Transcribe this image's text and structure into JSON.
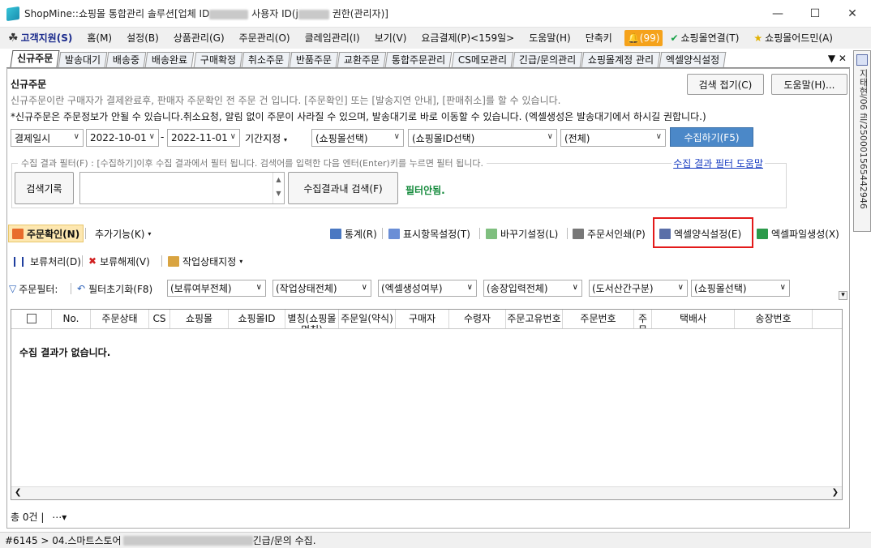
{
  "window": {
    "title_prefix": "ShopMine::쇼핑몰 통합관리 솔루션[업체 ID",
    "title_mid": " 사용자 ID(j",
    "title_suffix": " 권한(관리자)]",
    "minimize": "—",
    "maximize": "☐",
    "close": "✕"
  },
  "menu": {
    "brand": "고객지원(S)",
    "items": [
      "홈(M)",
      "설정(B)",
      "상품관리(G)",
      "주문관리(O)",
      "클레임관리(I)",
      "보기(V)",
      "요금결제(P)<159일>",
      "도움말(H)",
      "단축키"
    ],
    "bell_count": "(99)",
    "mall_connect": "쇼핑몰연결(T)",
    "mall_admin": "쇼핑몰어드민(A)"
  },
  "tabs": [
    "신규주문",
    "발송대기",
    "배송중",
    "배송완료",
    "구매확정",
    "취소주문",
    "반품주문",
    "교환주문",
    "통합주문관리",
    "CS메모관리",
    "긴급/문의관리",
    "쇼핑몰계정 관리",
    "엑셀양식설정"
  ],
  "tab_controls": "▼ ✕",
  "side_strip": "지태현/06 fil/250001565442946",
  "panel": {
    "title": "신규주문",
    "desc1": "신규주문이란 구매자가 결제완료후, 판매자 주문확인 전 주문 건 입니다. [주문확인] 또는 [발송지연 안내], [판매취소]를 할 수 있습니다.",
    "desc2": "*신규주문은 주문정보가 안될 수 있습니다.취소요청, 알림 없이 주문이 사라질 수 있으며, 발송대기로 바로 이동할 수 있습니다. (엑셀생성은 발송대기에서 하시길 권합니다.)",
    "btn_collapse": "검색 접기(C)",
    "btn_help": "도움말(H)..."
  },
  "search": {
    "date_type": "결제일시",
    "date_from": "2022-10-01",
    "date_sep": "-",
    "date_to": "2022-11-01",
    "period": "기간지정",
    "mall_select": "(쇼핑몰선택)",
    "mall_id_select": "(쇼핑몰ID선택)",
    "all": "(전체)",
    "collect": "수집하기(F5)"
  },
  "filter": {
    "legend": "수집 결과 필터(F) : [수집하기]이후 수집 결과에서 필터 됩니다. 검색어를 입력한 다음 엔터(Enter)키를 누르면 필터 됩니다.",
    "help_link": "수집 결과 필터 도움말",
    "history_btn": "검색기록",
    "search_btn": "수집결과내 검색(F)",
    "state": "필터안됨."
  },
  "toolbar1": {
    "confirm": "주문확인(N)",
    "extra": "추가기능(K)",
    "stats": "통계(R)",
    "columns": "표시항목설정(T)",
    "replace": "바꾸기설정(L)",
    "print": "주문서인쇄(P)",
    "excel_form": "엑셀양식설정(E)",
    "excel_create": "엑셀파일생성(X)"
  },
  "toolbar2": {
    "hold": "보류처리(D)",
    "release": "보류해제(V)",
    "work_state": "작업상태지정"
  },
  "filterbar": {
    "label": "주문필터:",
    "reset": "필터초기화(F8)",
    "combos": [
      "(보류여부전체)",
      "(작업상태전체)",
      "(엑셀생성여부)",
      "(송장입력전체)",
      "(도서산간구분)",
      "(쇼핑몰선택)"
    ]
  },
  "grid": {
    "columns": [
      "",
      "No.",
      "주문상태",
      "CS",
      "쇼핑몰",
      "쇼핑몰ID",
      "별칭(쇼핑몰명칭)",
      "주문일(약식)",
      "구매자",
      "수령자",
      "주문고유번호",
      "주문번호",
      "주문",
      "택배사",
      "송장번호"
    ],
    "empty": "수집 결과가 없습니다."
  },
  "footer": {
    "total": "총 0건 |"
  },
  "status": {
    "prefix": "#6145 > 04.스마트스토어",
    "suffix": " 긴급/문의 수집."
  }
}
